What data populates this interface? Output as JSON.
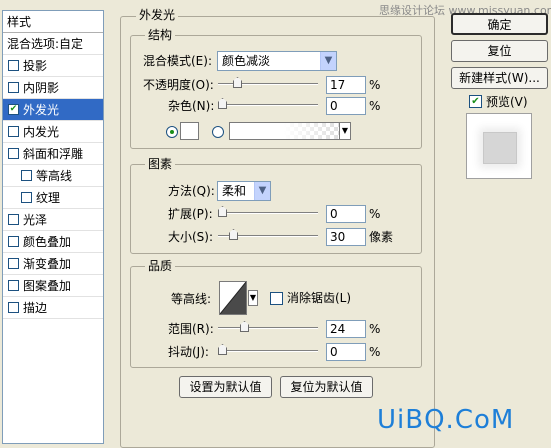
{
  "watermark": "思缘设计论坛 www.missyuan.com",
  "brand_watermark": "UiBQ.CoM",
  "style_list": {
    "header": "样式",
    "items": [
      {
        "label": "混合选项:自定",
        "checkbox": false,
        "indent": 0,
        "selected": false
      },
      {
        "label": "投影",
        "checkbox": true,
        "checked": false,
        "indent": 0,
        "selected": false
      },
      {
        "label": "内阴影",
        "checkbox": true,
        "checked": false,
        "indent": 0,
        "selected": false
      },
      {
        "label": "外发光",
        "checkbox": true,
        "checked": true,
        "indent": 0,
        "selected": true
      },
      {
        "label": "内发光",
        "checkbox": true,
        "checked": false,
        "indent": 0,
        "selected": false
      },
      {
        "label": "斜面和浮雕",
        "checkbox": true,
        "checked": false,
        "indent": 0,
        "selected": false
      },
      {
        "label": "等高线",
        "checkbox": true,
        "checked": false,
        "indent": 1,
        "selected": false
      },
      {
        "label": "纹理",
        "checkbox": true,
        "checked": false,
        "indent": 1,
        "selected": false
      },
      {
        "label": "光泽",
        "checkbox": true,
        "checked": false,
        "indent": 0,
        "selected": false
      },
      {
        "label": "颜色叠加",
        "checkbox": true,
        "checked": false,
        "indent": 0,
        "selected": false
      },
      {
        "label": "渐变叠加",
        "checkbox": true,
        "checked": false,
        "indent": 0,
        "selected": false
      },
      {
        "label": "图案叠加",
        "checkbox": true,
        "checked": false,
        "indent": 0,
        "selected": false
      },
      {
        "label": "描边",
        "checkbox": true,
        "checked": false,
        "indent": 0,
        "selected": false
      }
    ]
  },
  "outer_glow": {
    "title": "外发光",
    "structure": {
      "title": "结构",
      "blend_mode_label": "混合模式(E):",
      "blend_mode_value": "颜色减淡",
      "opacity_label": "不透明度(O):",
      "opacity_value": "17",
      "opacity_unit": "%",
      "opacity_fraction": 0.17,
      "noise_label": "杂色(N):",
      "noise_value": "0",
      "noise_unit": "%",
      "noise_fraction": 0.0
    },
    "elements": {
      "title": "图素",
      "method_label": "方法(Q):",
      "method_value": "柔和",
      "spread_label": "扩展(P):",
      "spread_value": "0",
      "spread_unit": "%",
      "spread_fraction": 0.0,
      "size_label": "大小(S):",
      "size_value": "30",
      "size_unit": "像素",
      "size_fraction": 0.12
    },
    "quality": {
      "title": "品质",
      "contour_label": "等高线:",
      "antialias_label": "消除锯齿(L)",
      "range_label": "范围(R):",
      "range_value": "24",
      "range_unit": "%",
      "range_fraction": 0.24,
      "jitter_label": "抖动(J):",
      "jitter_value": "0",
      "jitter_unit": "%",
      "jitter_fraction": 0.0
    },
    "make_default_label": "设置为默认值",
    "reset_default_label": "复位为默认值"
  },
  "right_panel": {
    "ok_label": "确定",
    "reset_label": "复位",
    "new_style_label": "新建样式(W)...",
    "preview_label": "预览(V)"
  }
}
